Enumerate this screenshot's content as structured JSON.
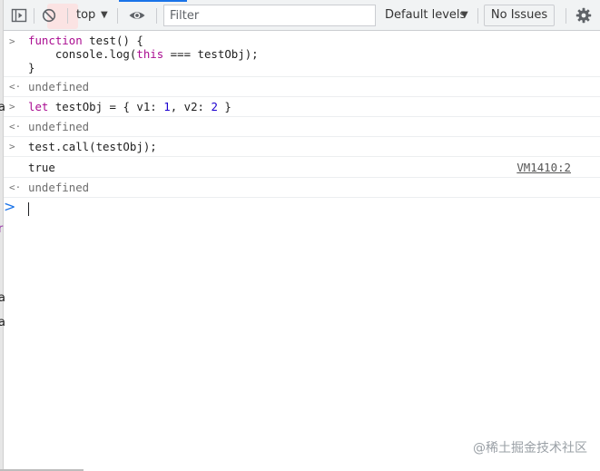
{
  "toolbar": {
    "context_value": "top",
    "filter_placeholder": "Filter",
    "levels_label": "Default levels",
    "issues_label": "No Issues",
    "icons": [
      "sidebar-toggle-icon",
      "clear-console-icon",
      "eye-icon",
      "gear-icon"
    ]
  },
  "console": {
    "entry1": {
      "line1_kw": "function",
      "line1_rest": " test() {",
      "line2_pre": "    console.log(",
      "line2_kw": "this",
      "line2_post": " === testObj);",
      "line3": "}"
    },
    "result1": "undefined",
    "entry2": {
      "kw": "let",
      "pre": " testObj = { v1: ",
      "n1": "1",
      "mid": ", v2: ",
      "n2": "2",
      "post": " }"
    },
    "result2": "undefined",
    "entry3": "test.call(testObj);",
    "log_output": "true",
    "log_source": "VM1410:2",
    "result3": "undefined"
  },
  "watermark": "@稀土掘金技术社区",
  "colors": {
    "keyword": "#aa0d91",
    "number": "#1c00cf",
    "accent": "#1a73e8",
    "toolbar_bg": "#f1f3f4"
  }
}
